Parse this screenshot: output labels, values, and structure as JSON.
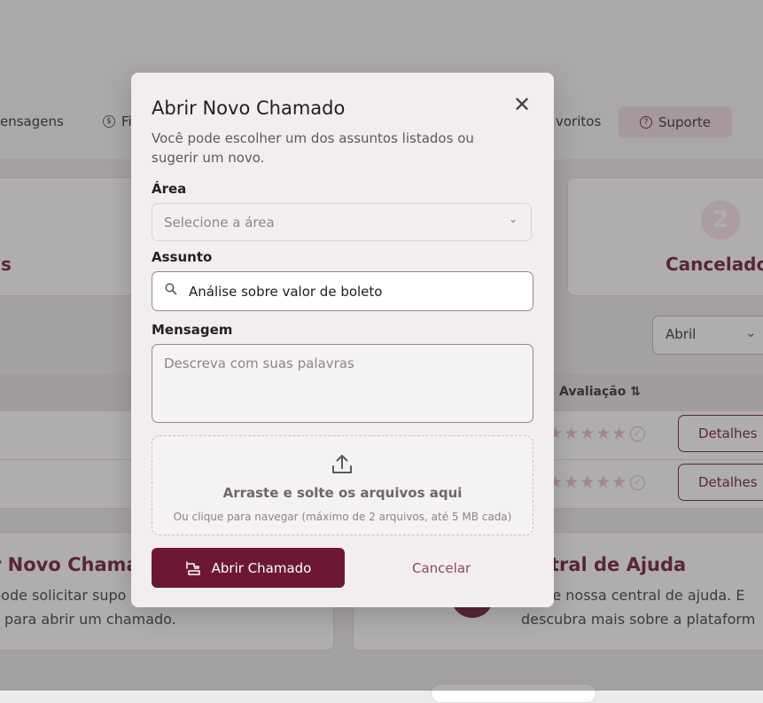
{
  "nav": {
    "messages": "ensagens",
    "finance": "Fi",
    "favorites": "voritos",
    "support": "Suporte"
  },
  "stats": {
    "left_label": "s",
    "right_number": "2",
    "right_label": "Cancelado"
  },
  "filters": {
    "month": "Abril"
  },
  "table": {
    "rating_header": "Avaliação ⇅",
    "rows": [
      {
        "stars": "★★★★★",
        "button": "Detalhes"
      },
      {
        "stars": "★★★★★",
        "button": "Detalhes"
      }
    ]
  },
  "help_left": {
    "title": "r Novo Chamad",
    "line1": "pode solicitar supo",
    "line2": "para abrir um chamado."
  },
  "help_right": {
    "title": "ntral de Ajuda",
    "line1": "se nossa central de ajuda. E",
    "line2": "descubra mais sobre a plataform"
  },
  "modal": {
    "title": "Abrir Novo Chamado",
    "description": "Você pode escolher um dos assuntos listados ou sugerir um novo.",
    "area_label": "Área",
    "area_placeholder": "Selecione a área",
    "subject_label": "Assunto",
    "subject_value": "Análise sobre valor de boleto",
    "message_label": "Mensagem",
    "message_placeholder": "Descreva com suas palavras",
    "drop_title": "Arraste e solte os arquivos aqui",
    "drop_subtitle": "Ou clique para navegar (máximo de 2 arquivos, até 5 MB cada)",
    "submit_label": "Abrir Chamado",
    "cancel_label": "Cancelar"
  },
  "colors": {
    "brand": "#6d1832",
    "support_bg": "#f0dbe3",
    "modal_bg": "#f2eef0"
  }
}
